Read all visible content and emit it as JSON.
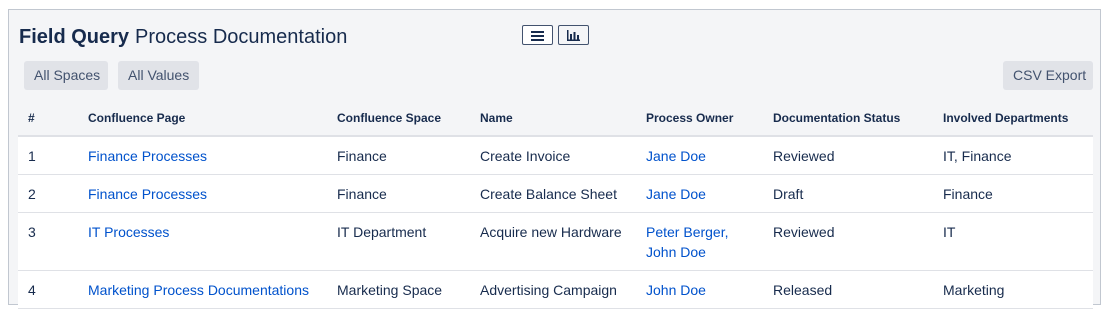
{
  "header": {
    "title_bold": "Field Query",
    "title_rest": "Process Documentation"
  },
  "view_toggle": {
    "list_icon": "list-icon",
    "chart_icon": "bar-chart-icon"
  },
  "toolbar": {
    "all_spaces": "All Spaces",
    "all_values": "All Values",
    "csv_export": "CSV Export"
  },
  "table": {
    "columns": [
      "#",
      "Confluence Page",
      "Confluence Space",
      "Name",
      "Process Owner",
      "Documentation Status",
      "Involved Departments"
    ],
    "rows": [
      {
        "num": "1",
        "page": "Finance Processes",
        "space": "Finance",
        "name": "Create Invoice",
        "owners": [
          "Jane Doe"
        ],
        "status": "Reviewed",
        "departments": "IT, Finance"
      },
      {
        "num": "2",
        "page": "Finance Processes",
        "space": "Finance",
        "name": "Create Balance Sheet",
        "owners": [
          "Jane Doe"
        ],
        "status": "Draft",
        "departments": "Finance"
      },
      {
        "num": "3",
        "page": "IT Processes",
        "space": "IT Department",
        "name": "Acquire new Hardware",
        "owners": [
          "Peter Berger,",
          "John Doe"
        ],
        "status": "Reviewed",
        "departments": "IT"
      },
      {
        "num": "4",
        "page": "Marketing Process Documentations",
        "space": "Marketing Space",
        "name": "Advertising Campaign",
        "owners": [
          "John Doe"
        ],
        "status": "Released",
        "departments": "Marketing"
      }
    ]
  },
  "colors": {
    "link": "#0052cc",
    "text": "#172b4d",
    "panel_bg": "#f4f5f7",
    "button_bg": "#e1e3e8"
  }
}
